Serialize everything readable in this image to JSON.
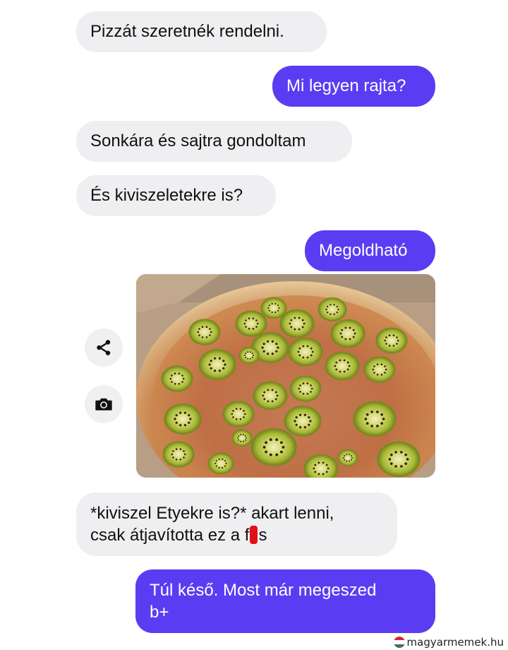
{
  "messages": [
    {
      "side": "incoming",
      "text": "Pizzát szeretnék rendelni."
    },
    {
      "side": "outgoing",
      "text": "Mi legyen rajta?"
    },
    {
      "side": "incoming",
      "text": "Sonkára és sajtra gondoltam"
    },
    {
      "side": "incoming",
      "text": "És kiviszeletekre is?"
    },
    {
      "side": "outgoing",
      "text": "Megoldható"
    },
    {
      "side": "outgoing",
      "type": "image",
      "image": "pizza-with-kiwi-slices"
    },
    {
      "side": "incoming",
      "lines": [
        "*kiviszel Etyekre is?* akart lenni,",
        "csak átjavította ez a f",
        "s"
      ]
    },
    {
      "side": "outgoing",
      "lines": [
        "Túl késő. Most már megeszed",
        "b+"
      ]
    }
  ],
  "actions": {
    "share_icon": "share-icon",
    "camera_icon": "camera-icon"
  },
  "watermark": "magyarmemek.hu",
  "colors": {
    "outgoing_bubble": "#5a3df2",
    "incoming_bubble": "#efeff1",
    "redaction": "#e01218"
  }
}
